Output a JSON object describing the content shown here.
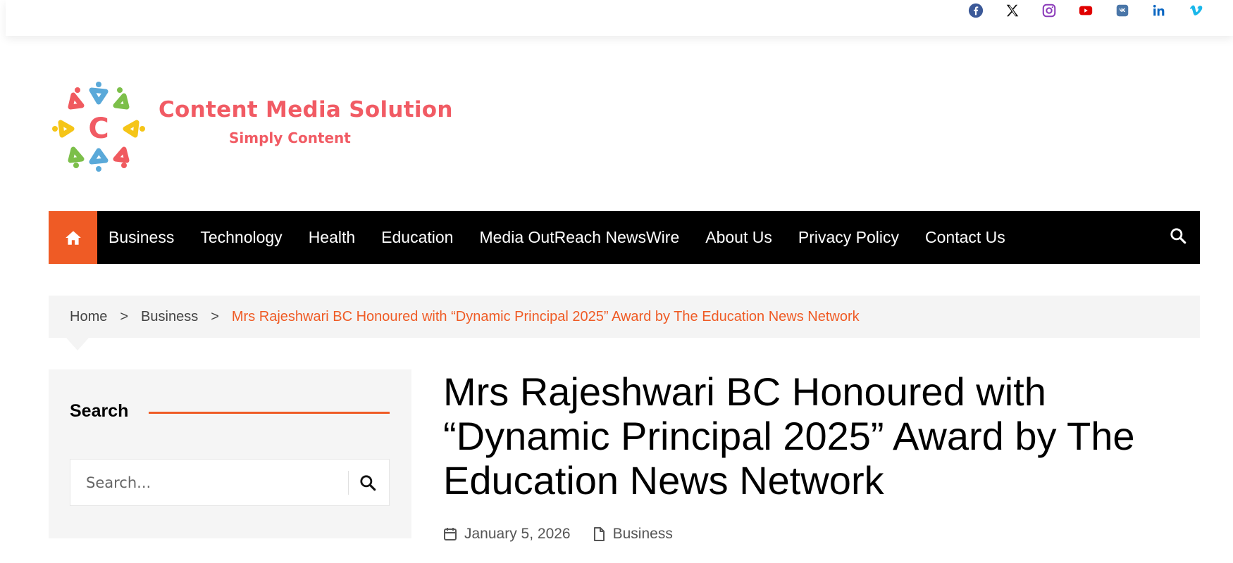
{
  "social": [
    "facebook-icon",
    "x-icon",
    "instagram-icon",
    "youtube-icon",
    "vk-icon",
    "linkedin-icon",
    "vimeo-icon"
  ],
  "brand": {
    "title": "Content Media Solution",
    "tagline": "Simply Content",
    "logo_letter": "C",
    "color": "#f15b64"
  },
  "nav": {
    "items": [
      "Business",
      "Technology",
      "Health",
      "Education",
      "Media OutReach NewsWire",
      "About Us",
      "Privacy Policy",
      "Contact Us"
    ]
  },
  "breadcrumb": {
    "home": "Home",
    "category": "Business",
    "separator": ">",
    "current": "Mrs Rajeshwari BC Honoured with “Dynamic Principal 2025” Award by The Education News Network"
  },
  "sidebar": {
    "search_title": "Search",
    "search_placeholder": "Search..."
  },
  "article": {
    "title": "Mrs Rajeshwari BC Honoured with “Dynamic Principal 2025” Award by The Education News Network",
    "date": "January 5, 2026",
    "category": "Business"
  },
  "colors": {
    "accent": "#ef5b25",
    "nav_bg": "#000000",
    "brand": "#f15b64"
  }
}
